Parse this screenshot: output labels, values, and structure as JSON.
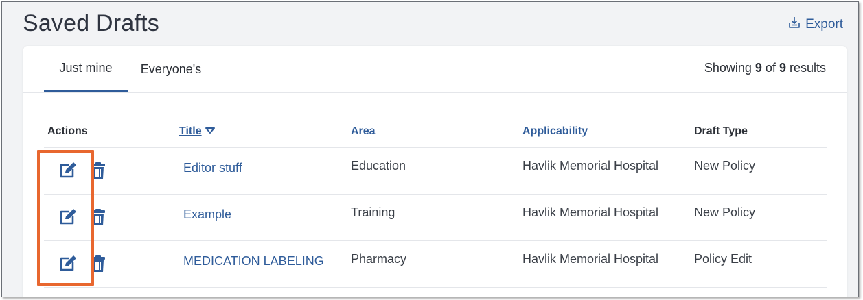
{
  "page": {
    "title": "Saved Drafts",
    "export_label": "Export"
  },
  "tabs": [
    {
      "label": "Just mine"
    },
    {
      "label": "Everyone's"
    }
  ],
  "results": {
    "prefix": "Showing",
    "shown": "9",
    "of": "of",
    "total": "9",
    "suffix": "results"
  },
  "table": {
    "headers": {
      "actions": "Actions",
      "title": "Title",
      "area": "Area",
      "applicability": "Applicability",
      "draft_type": "Draft Type"
    },
    "rows": [
      {
        "title": "Editor stuff",
        "area": "Education",
        "applicability": "Havlik Memorial Hospital",
        "draft_type": "New Policy"
      },
      {
        "title": "Example",
        "area": "Training",
        "applicability": "Havlik Memorial Hospital",
        "draft_type": "New Policy"
      },
      {
        "title": "MEDICATION LABELING",
        "area": "Pharmacy",
        "applicability": "Havlik Memorial Hospital",
        "draft_type": "Policy Edit"
      }
    ]
  },
  "icons": {
    "export": "export-icon",
    "sort": "sort-desc-icon",
    "edit": "edit-icon",
    "delete": "trash-icon"
  },
  "colors": {
    "accent": "#2f5c9a",
    "highlight": "#e8672f",
    "background": "#f2f3f5"
  }
}
